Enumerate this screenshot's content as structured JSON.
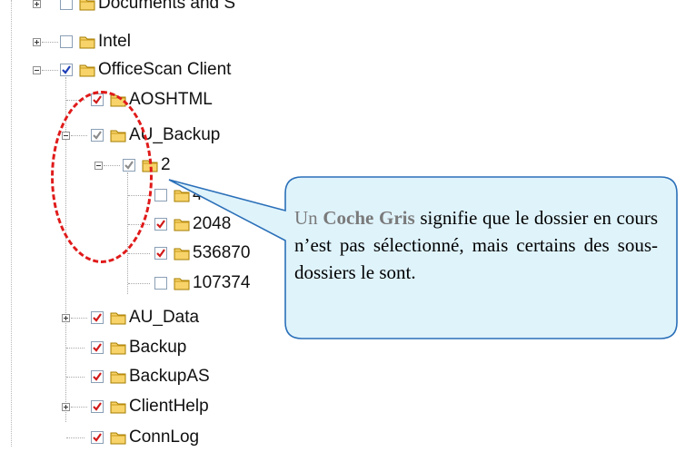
{
  "tree": {
    "items": [
      {
        "label": "Documents and S",
        "state": "empty",
        "expander": "plus"
      },
      {
        "label": "Intel",
        "state": "empty",
        "expander": "plus"
      },
      {
        "label": "OfficeScan Client",
        "state": "blue",
        "expander": "minus"
      },
      {
        "label": "AOSHTML",
        "state": "red",
        "expander": "none"
      },
      {
        "label": "AU_Backup",
        "state": "grey",
        "expander": "minus"
      },
      {
        "label": "2",
        "state": "grey",
        "expander": "minus"
      },
      {
        "label": "4",
        "state": "empty",
        "expander": "none"
      },
      {
        "label": "2048",
        "state": "red",
        "expander": "none"
      },
      {
        "label": "536870",
        "state": "red",
        "expander": "none"
      },
      {
        "label": "107374",
        "state": "empty",
        "expander": "none"
      },
      {
        "label": "AU_Data",
        "state": "red",
        "expander": "plus"
      },
      {
        "label": "Backup",
        "state": "red",
        "expander": "none"
      },
      {
        "label": "BackupAS",
        "state": "red",
        "expander": "none"
      },
      {
        "label": "ClientHelp",
        "state": "red",
        "expander": "plus"
      },
      {
        "label": "ConnLog",
        "state": "red",
        "expander": "none"
      }
    ]
  },
  "callout": {
    "word_un": "Un",
    "word_coche_gris": "Coche Gris",
    "rest": "signifie que le dossier en cours n’est pas sélectionné, mais certains des sous-dossiers le sont."
  },
  "colors": {
    "red_check": "#d11a1a",
    "blue_check": "#1e3fb8",
    "grey_check": "#8c8c8c",
    "callout_fill": "#dff3fb",
    "callout_border": "#2a6fb8",
    "annotation_red": "#e01a1a"
  }
}
